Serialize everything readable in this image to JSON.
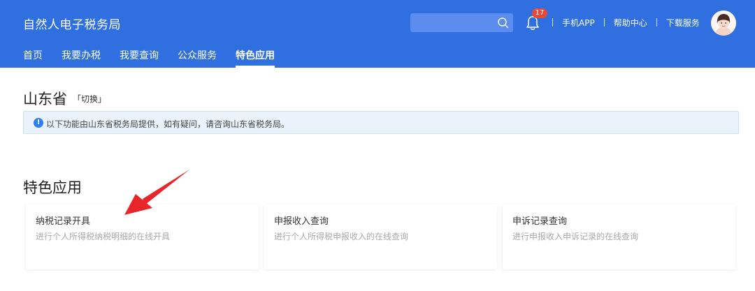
{
  "header": {
    "site_title": "自然人电子税务局",
    "search": {
      "placeholder": ""
    },
    "notifications": {
      "count": "17"
    },
    "links": [
      "手机APP",
      "帮助中心",
      "下载服务"
    ]
  },
  "nav": {
    "items": [
      "首页",
      "我要办税",
      "我要查询",
      "公众服务",
      "特色应用"
    ],
    "active": "特色应用"
  },
  "region": {
    "province": "山东省",
    "switch_label": "「切换」"
  },
  "notice": {
    "text": "以下功能由山东省税务局提供，如有疑问，请咨询山东省税务局。"
  },
  "section": {
    "title": "特色应用"
  },
  "cards": [
    {
      "title": "纳税记录开具",
      "desc": "进行个人所得税纳税明细的在线开具"
    },
    {
      "title": "申报收入查询",
      "desc": "进行个人所得税申报收入的在线查询"
    },
    {
      "title": "申诉记录查询",
      "desc": "进行申报收入申诉记录的在线查询"
    }
  ],
  "colors": {
    "header_bg": "#2f6fe0",
    "notice_bg": "#eaf3fc",
    "annotation_arrow": "#e8262a"
  }
}
